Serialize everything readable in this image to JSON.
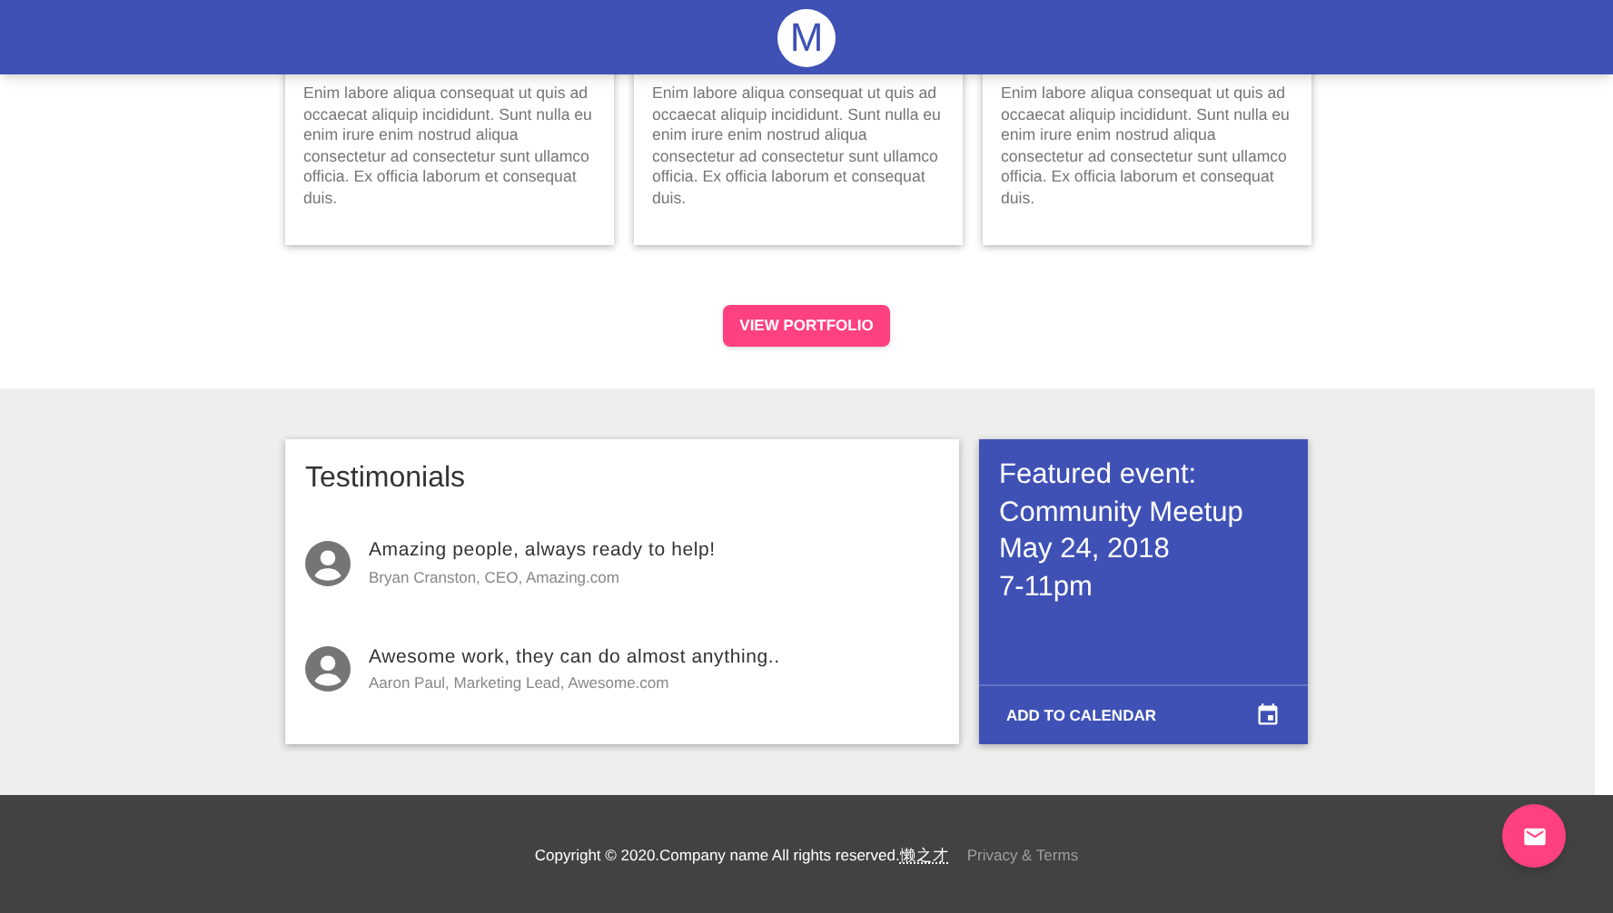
{
  "header": {
    "logo": "M"
  },
  "cards": [
    {
      "text": "Enim labore aliqua consequat ut quis ad occaecat aliquip incididunt. Sunt nulla eu enim irure enim nostrud aliqua consectetur ad consectetur sunt ullamco officia. Ex officia laborum et consequat duis."
    },
    {
      "text": "Enim labore aliqua consequat ut quis ad occaecat aliquip incididunt. Sunt nulla eu enim irure enim nostrud aliqua consectetur ad consectetur sunt ullamco officia. Ex officia laborum et consequat duis."
    },
    {
      "text": "Enim labore aliqua consequat ut quis ad occaecat aliquip incididunt. Sunt nulla eu enim irure enim nostrud aliqua consectetur ad consectetur sunt ullamco officia. Ex officia laborum et consequat duis."
    }
  ],
  "portfolio_button": "VIEW PORTFOLIO",
  "testimonials": {
    "title": "Testimonials",
    "items": [
      {
        "quote": "Amazing people, always ready to help!",
        "author": "Bryan Cranston, CEO, Amazing.com"
      },
      {
        "quote": "Awesome work, they can do almost anything..",
        "author": "Aaron Paul, Marketing Lead, Awesome.com"
      }
    ]
  },
  "event": {
    "lines": [
      "Featured event:",
      "Community Meetup",
      "May 24, 2018",
      "7-11pm"
    ],
    "action": "ADD TO CALENDAR"
  },
  "footer": {
    "copyright": "Copyright © 2020.Company name All rights reserved.",
    "link": "懒之才",
    "privacy": "Privacy & Terms"
  }
}
